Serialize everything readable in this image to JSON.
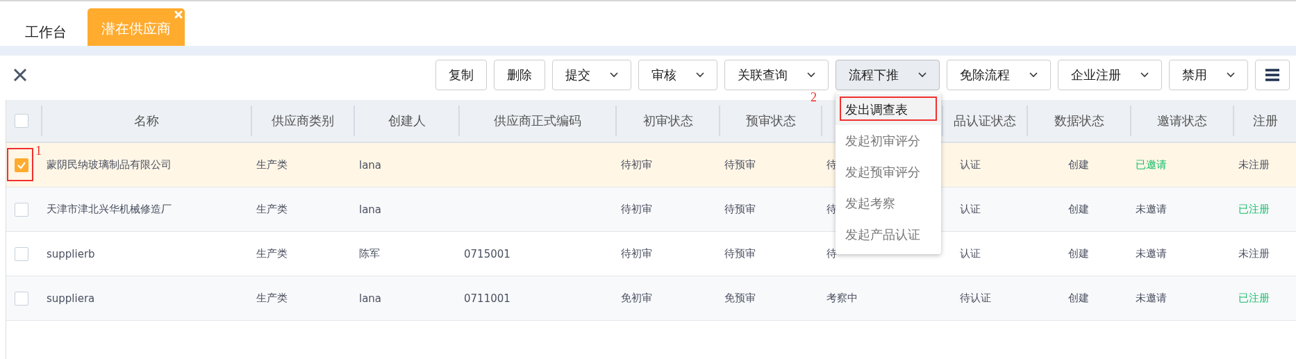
{
  "tabs": [
    {
      "label": "工作台",
      "selected": false
    },
    {
      "label": "潜在供应商",
      "selected": true,
      "closable": true
    }
  ],
  "toolbar": {
    "buttons": [
      {
        "label": "复制",
        "kind": "plain",
        "active": false
      },
      {
        "label": "删除",
        "kind": "plain",
        "active": false
      },
      {
        "label": "提交",
        "kind": "dropdown",
        "active": false
      },
      {
        "label": "审核",
        "kind": "dropdown",
        "active": false
      },
      {
        "label": "关联查询",
        "kind": "dropdown",
        "active": false
      },
      {
        "label": "流程下推",
        "kind": "dropdown",
        "active": true,
        "menu": [
          {
            "label": "发出调查表",
            "selected": true,
            "annotation": "2"
          },
          {
            "label": "发起初审评分",
            "selected": false
          },
          {
            "label": "发起预审评分",
            "selected": false
          },
          {
            "label": "发起考察",
            "selected": false
          },
          {
            "label": "发起产品认证",
            "selected": false
          }
        ]
      },
      {
        "label": "免除流程",
        "kind": "dropdown",
        "active": false
      },
      {
        "label": "企业注册",
        "kind": "dropdown",
        "active": false
      },
      {
        "label": "禁用",
        "kind": "dropdown",
        "active": false
      },
      {
        "kind": "menu"
      }
    ]
  },
  "table": {
    "all_selected": false,
    "columns": [
      "名称",
      "供应商类别",
      "创建人",
      "供应商正式编码",
      "初审状态",
      "预审状态",
      "",
      "品认证状态",
      "数据状态",
      "邀请状态",
      "注册"
    ],
    "rows": [
      {
        "selected": true,
        "annotation": "1",
        "cells": [
          "蒙阴民纳玻璃制品有限公司",
          "生产类",
          "lana",
          "",
          "待初审",
          "待预审",
          "待",
          "认证",
          "创建"
        ],
        "invite": {
          "text": "已邀请",
          "on": true
        },
        "register": {
          "text": "未注册",
          "on": false
        }
      },
      {
        "selected": false,
        "cells": [
          "天津市津北兴华机械修造厂",
          "生产类",
          "lana",
          "",
          "待初审",
          "待预审",
          "待",
          "认证",
          "创建"
        ],
        "invite": {
          "text": "未邀请",
          "on": false
        },
        "register": {
          "text": "已注册",
          "on": true
        }
      },
      {
        "selected": false,
        "cells": [
          "supplierb",
          "生产类",
          "陈军",
          "0715001",
          "待初审",
          "待预审",
          "待",
          "认证",
          "创建"
        ],
        "invite": {
          "text": "未邀请",
          "on": false
        },
        "register": {
          "text": "未注册",
          "on": false
        }
      },
      {
        "selected": false,
        "cells": [
          "suppliera",
          "生产类",
          "lana",
          "0711001",
          "免初审",
          "免预审",
          "考察中",
          "待认证",
          "创建"
        ],
        "invite": {
          "text": "未邀请",
          "on": false
        },
        "register": {
          "text": "已注册",
          "on": true
        }
      }
    ]
  }
}
